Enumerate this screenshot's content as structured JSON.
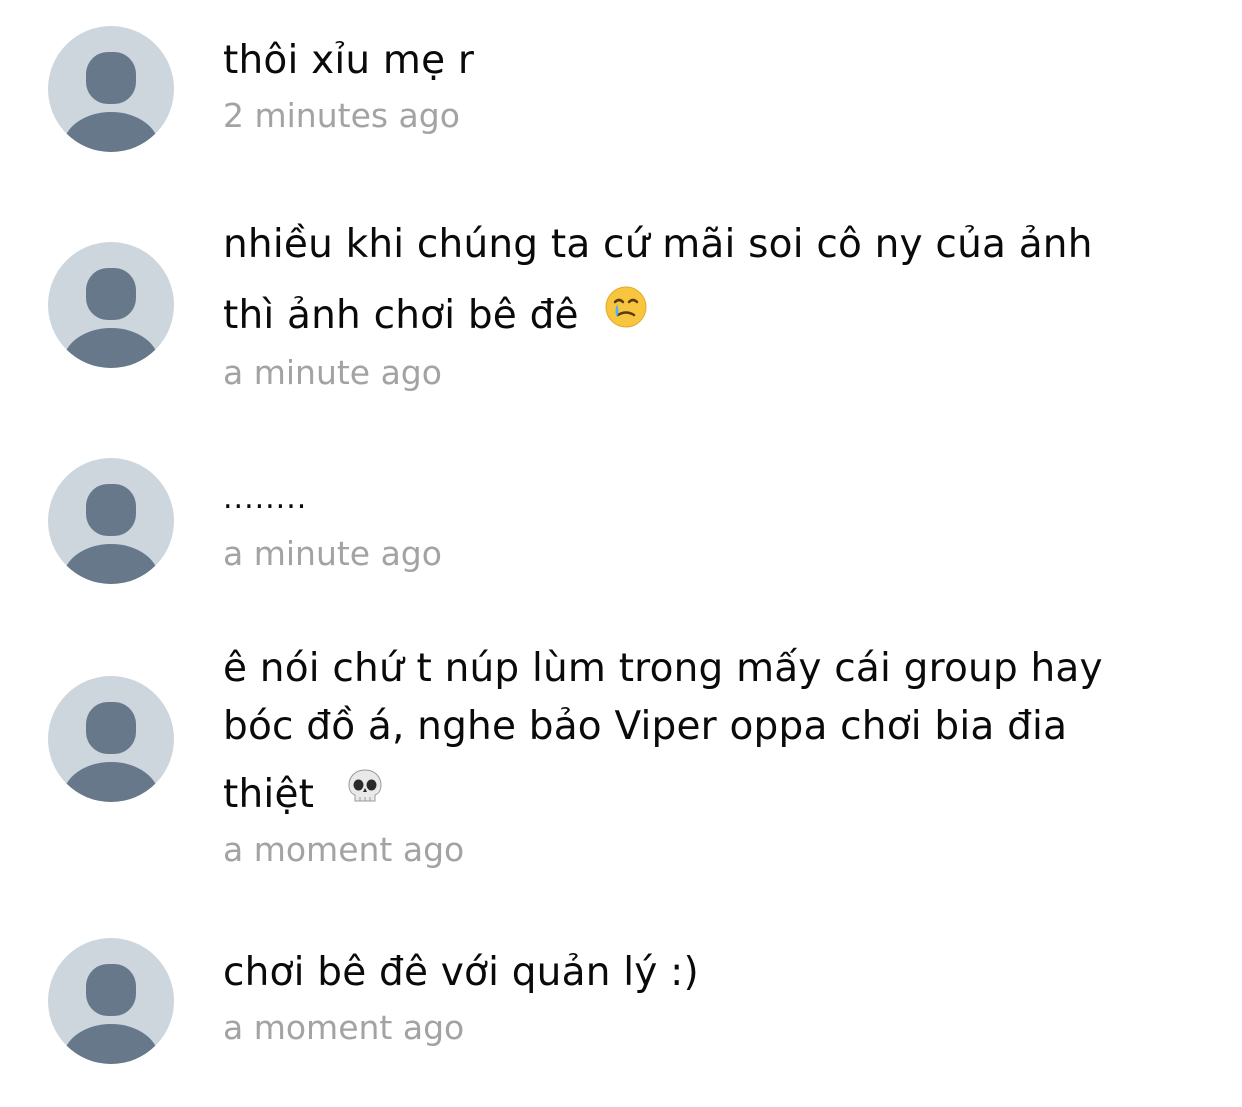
{
  "comments": [
    {
      "text": "thôi xỉu mẹ r",
      "time": "2 minutes ago",
      "emoji": ""
    },
    {
      "text_lines": [
        "nhiều khi chúng ta cứ mãi soi cô ny của ảnh",
        "thì ảnh chơi bê đê"
      ],
      "time": "a minute ago",
      "emoji": "crying-smile-emoji"
    },
    {
      "text": "........",
      "time": "a minute ago",
      "emoji": ""
    },
    {
      "text_lines": [
        "ê nói chứ t núp lùm trong mấy cái group hay",
        "bóc đồ á, nghe bảo Viper oppa chơi bia đia",
        "thiệt"
      ],
      "time": "a moment ago",
      "emoji": "skull-emoji"
    },
    {
      "text": "chơi bê đê với quản lý :)",
      "time": "a moment ago",
      "emoji": ""
    }
  ],
  "colors": {
    "avatar_bg": "#cdd6dd",
    "avatar_fg": "#66788a",
    "timestamp": "#a3a3a3",
    "text": "#0a0a0a"
  }
}
